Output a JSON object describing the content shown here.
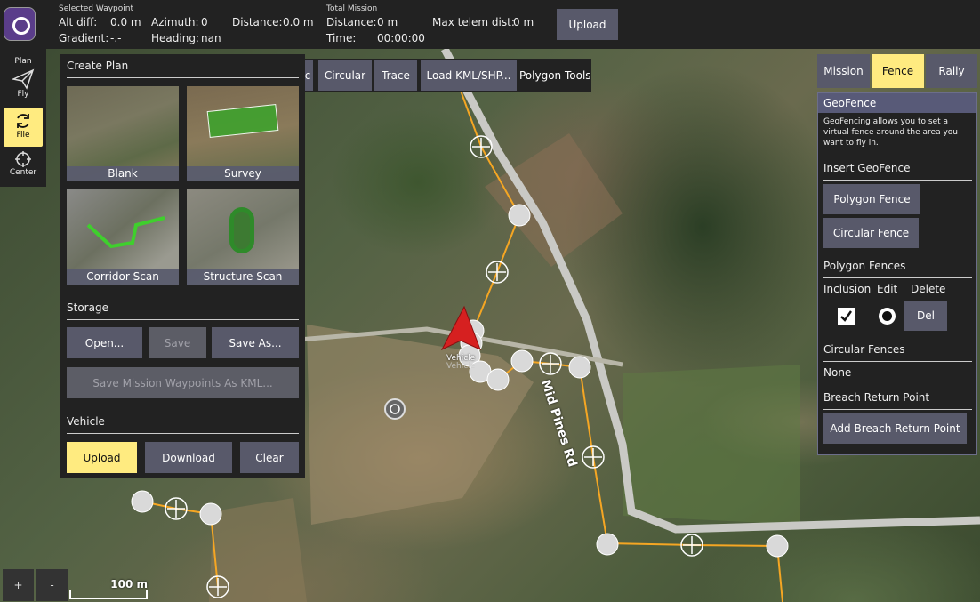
{
  "app": {
    "logo": "qgc-logo-icon"
  },
  "topbar": {
    "selected_waypoint_title": "Selected Waypoint",
    "alt_diff_label": "Alt diff:",
    "alt_diff_value": "0.0 m",
    "gradient_label": "Gradient:",
    "gradient_value": "-.-",
    "azimuth_label": "Azimuth:",
    "azimuth_value": "0",
    "heading_label": "Heading:",
    "heading_value": "nan",
    "distance_label": "Distance:",
    "distance_value": "0.0 m",
    "total_mission_title": "Total Mission",
    "total_distance_label": "Distance:",
    "total_distance_value": "0 m",
    "time_label": "Time:",
    "time_value": "00:00:00",
    "max_telem_label": "Max telem dist:",
    "max_telem_value": "0 m",
    "upload_label": "Upload"
  },
  "left_toolbar": {
    "plan_label": "Plan",
    "items": [
      {
        "label": "Fly",
        "icon": "paper-plane-icon"
      },
      {
        "label": "File",
        "icon": "sync-icon",
        "active": true
      },
      {
        "label": "Center",
        "icon": "crosshair-icon"
      }
    ]
  },
  "create_plan": {
    "title": "Create Plan",
    "templates": [
      "Blank",
      "Survey",
      "Corridor Scan",
      "Structure Scan"
    ],
    "storage_title": "Storage",
    "open_label": "Open...",
    "save_label": "Save",
    "save_as_label": "Save As...",
    "save_kml_label": "Save Mission Waypoints As KML...",
    "vehicle_title": "Vehicle",
    "upload_label": "Upload",
    "download_label": "Download",
    "clear_label": "Clear"
  },
  "polygon_tools": {
    "partial_label": "c",
    "circular_label": "Circular",
    "trace_label": "Trace",
    "load_kml_label": "Load KML/SHP...",
    "title": "Polygon Tools"
  },
  "right_tabs": {
    "mission": "Mission",
    "fence": "Fence",
    "rally": "Rally",
    "active": "Fence"
  },
  "geofence": {
    "title": "GeoFence",
    "description": "GeoFencing allows you to set a virtual fence around the area you want to fly in.",
    "insert_title": "Insert GeoFence",
    "polygon_fence_label": "Polygon Fence",
    "circular_fence_label": "Circular Fence",
    "polygon_fences_title": "Polygon Fences",
    "col_inclusion": "Inclusion",
    "col_edit": "Edit",
    "col_delete": "Delete",
    "inclusion_checked": true,
    "del_label": "Del",
    "circular_fences_title": "Circular Fences",
    "circular_fences_value": "None",
    "breach_title": "Breach Return Point",
    "add_breach_label": "Add Breach Return Point"
  },
  "map": {
    "road_label": "Mid Pines Rd",
    "vehicle_label": "Vehicle",
    "vehicle_label_shadow": "Vehicle",
    "scale_label": "100 m",
    "zoom_in": "+",
    "zoom_out": "-",
    "path_color": "#f5a623",
    "vehicle_color": "#d62020"
  }
}
